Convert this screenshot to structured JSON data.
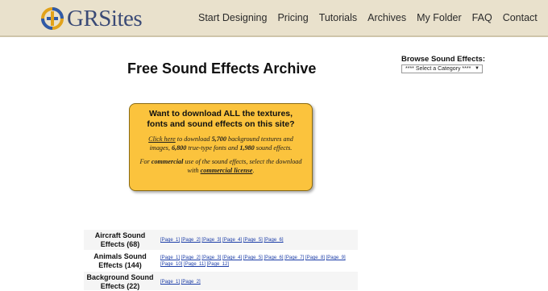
{
  "site": {
    "logo_text": "GRSites"
  },
  "nav": [
    {
      "label": "Start Designing"
    },
    {
      "label": "Pricing"
    },
    {
      "label": "Tutorials"
    },
    {
      "label": "Archives"
    },
    {
      "label": "My Folder"
    },
    {
      "label": "FAQ"
    },
    {
      "label": "Contact"
    }
  ],
  "page": {
    "title": "Free Sound Effects Archive"
  },
  "sidebar": {
    "title": "Browse Sound Effects:",
    "select_value": "**** Select a Category ****"
  },
  "promo": {
    "heading": "Want to download ALL the textures, fonts and sound effects on this site?",
    "link1": "Click here",
    "p1_a": " to download ",
    "p1_b": "5,700",
    "p1_c": " background textures and images, ",
    "p1_d": "6,800",
    "p1_e": " true-type fonts and ",
    "p1_f": "1,980",
    "p1_g": " sound effects.",
    "p2_a": "For ",
    "p2_b": "commercial",
    "p2_c": " use of the sound effects, select the download with ",
    "link2": "commercial license",
    "p2_d": "."
  },
  "categories": [
    {
      "name": "Aircraft Sound Effects (68)",
      "pages": [
        "[Page_1]",
        "[Page_2]",
        "[Page_3]",
        "[Page_4]",
        "[Page_5]",
        "[Page_6]"
      ]
    },
    {
      "name": "Animals Sound Effects (144)",
      "pages": [
        "[Page_1]",
        "[Page_2]",
        "[Page_3]",
        "[Page_4]",
        "[Page_5]",
        "[Page_6]",
        "[Page_7]",
        "[Page_8]",
        "[Page_9]",
        "[Page_10]",
        "[Page_11]",
        "[Page_12]"
      ]
    },
    {
      "name": "Background Sound Effects (22)",
      "pages": [
        "[Page_1]",
        "[Page_2]"
      ]
    }
  ],
  "colors": {
    "header_bg": "#e9e1cc",
    "promo_bg": "#fbc33d",
    "link": "#1d3ea8",
    "logo_text": "#3a4a76"
  }
}
